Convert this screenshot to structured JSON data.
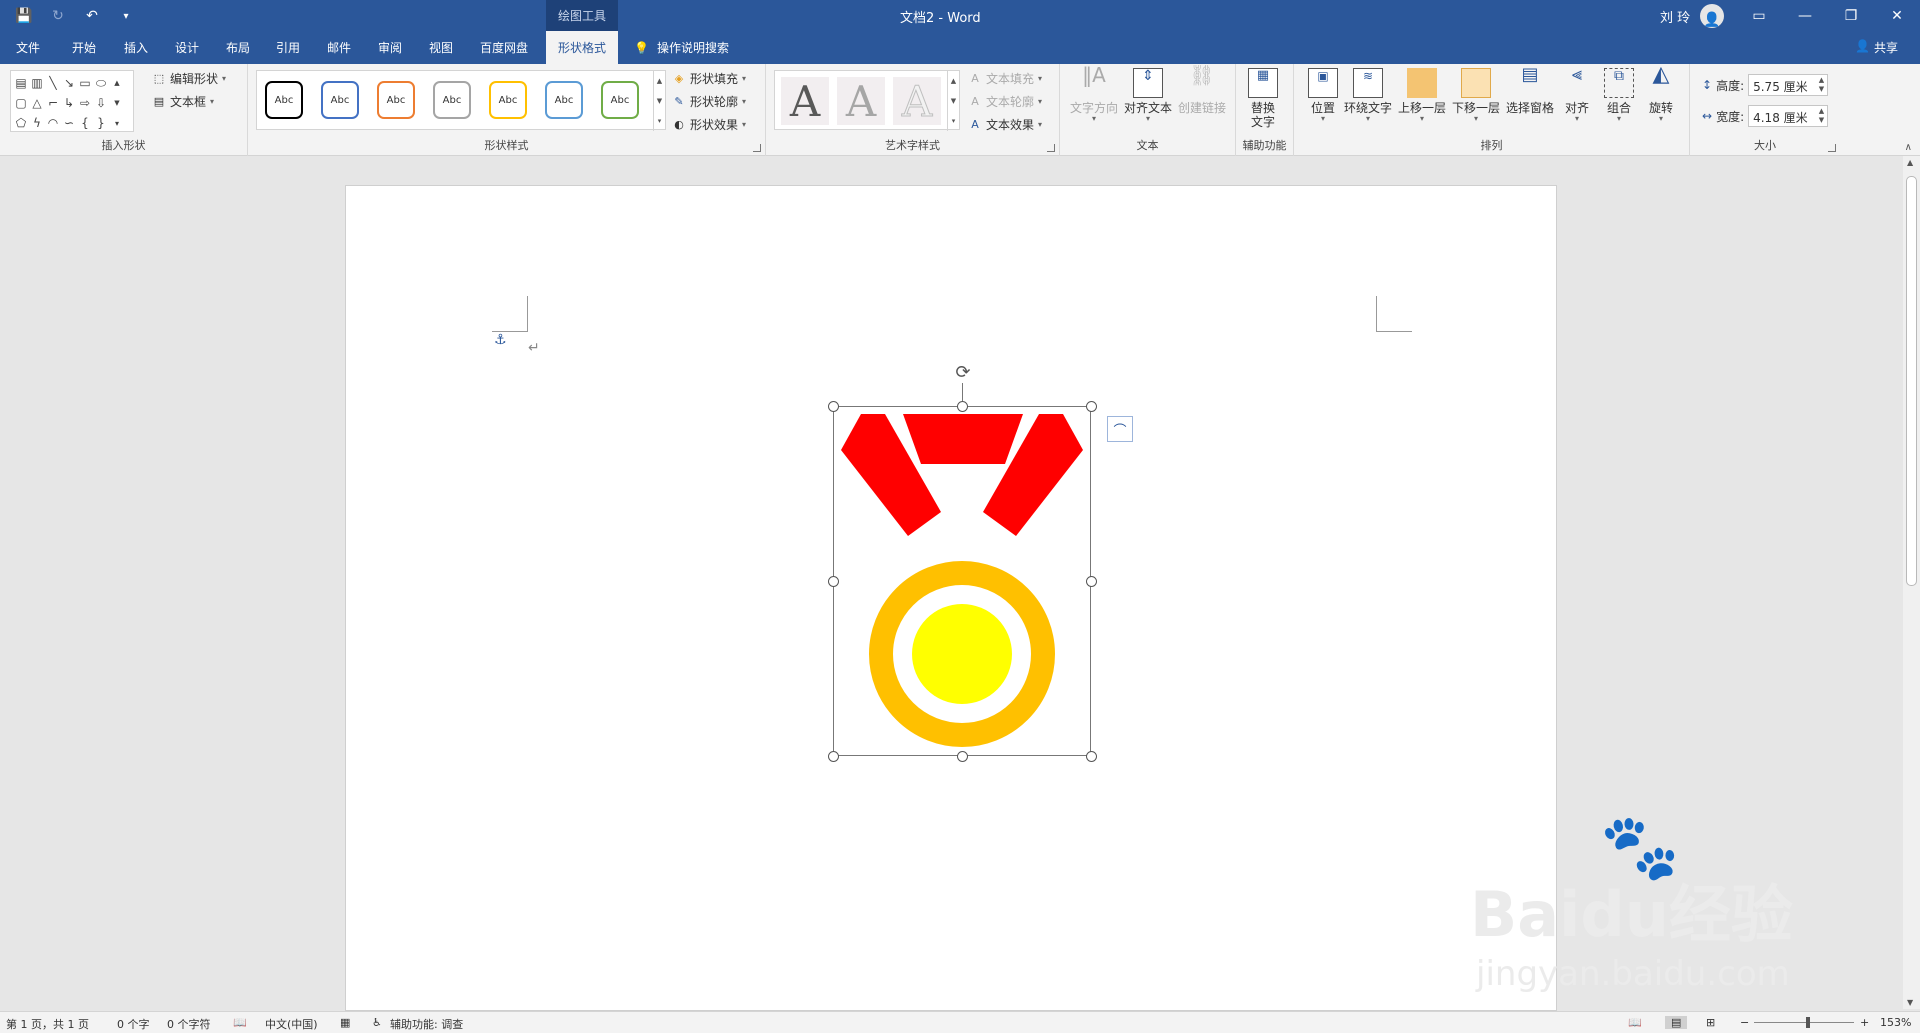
{
  "window": {
    "contextual_group": "绘图工具",
    "doc_title": "文档2  -  Word",
    "user_name": "刘 玲",
    "minimize": "—",
    "restore": "❐",
    "close": "✕"
  },
  "tabs": [
    "文件",
    "开始",
    "插入",
    "设计",
    "布局",
    "引用",
    "邮件",
    "审阅",
    "视图",
    "百度网盘",
    "形状格式"
  ],
  "tell_me": "操作说明搜索",
  "share": "共享",
  "ribbon": {
    "insert_shapes": {
      "label": "插入形状",
      "edit_shape": "编辑形状",
      "text_box": "文本框"
    },
    "shape_styles": {
      "label": "形状样式",
      "chip_text": "Abc",
      "chip_colors": [
        "#000000",
        "#4472c4",
        "#ed7d31",
        "#a5a5a5",
        "#ffc000",
        "#5b9bd5",
        "#70ad47"
      ],
      "fill": "形状填充",
      "outline": "形状轮廓",
      "effects": "形状效果"
    },
    "wordart_styles": {
      "label": "艺术字样式",
      "letter": "A",
      "text_fill": "文本填充",
      "text_outline": "文本轮廓",
      "text_effects": "文本效果"
    },
    "text": {
      "label": "文本",
      "direction": "文字方向",
      "align": "对齐文本",
      "link": "创建链接"
    },
    "accessibility": {
      "label": "辅助功能",
      "alt_text_line1": "替换",
      "alt_text_line2": "文字"
    },
    "arrange": {
      "label": "排列",
      "position": "位置",
      "wrap": "环绕文字",
      "forward": "上移一层",
      "backward": "下移一层",
      "pane": "选择窗格",
      "align": "对齐",
      "group": "组合",
      "rotate": "旋转"
    },
    "size": {
      "label": "大小",
      "height_label": "高度:",
      "height_value": "5.75 厘米",
      "width_label": "宽度:",
      "width_value": "4.18 厘米"
    }
  },
  "medal": {
    "ribbon_color": "#ff0000",
    "ring_color": "#ffc000",
    "inner_color": "#ffff00"
  },
  "status": {
    "page": "第 1 页，共 1 页",
    "words": "0 个字",
    "chars": "0 个字符",
    "language": "中文(中国)",
    "accessibility": "辅助功能: 调查",
    "zoom": "153%",
    "zoom_out": "−",
    "zoom_in": "+"
  },
  "watermark": {
    "brand": "Baidu经验",
    "url": "jingyan.baidu.com"
  }
}
